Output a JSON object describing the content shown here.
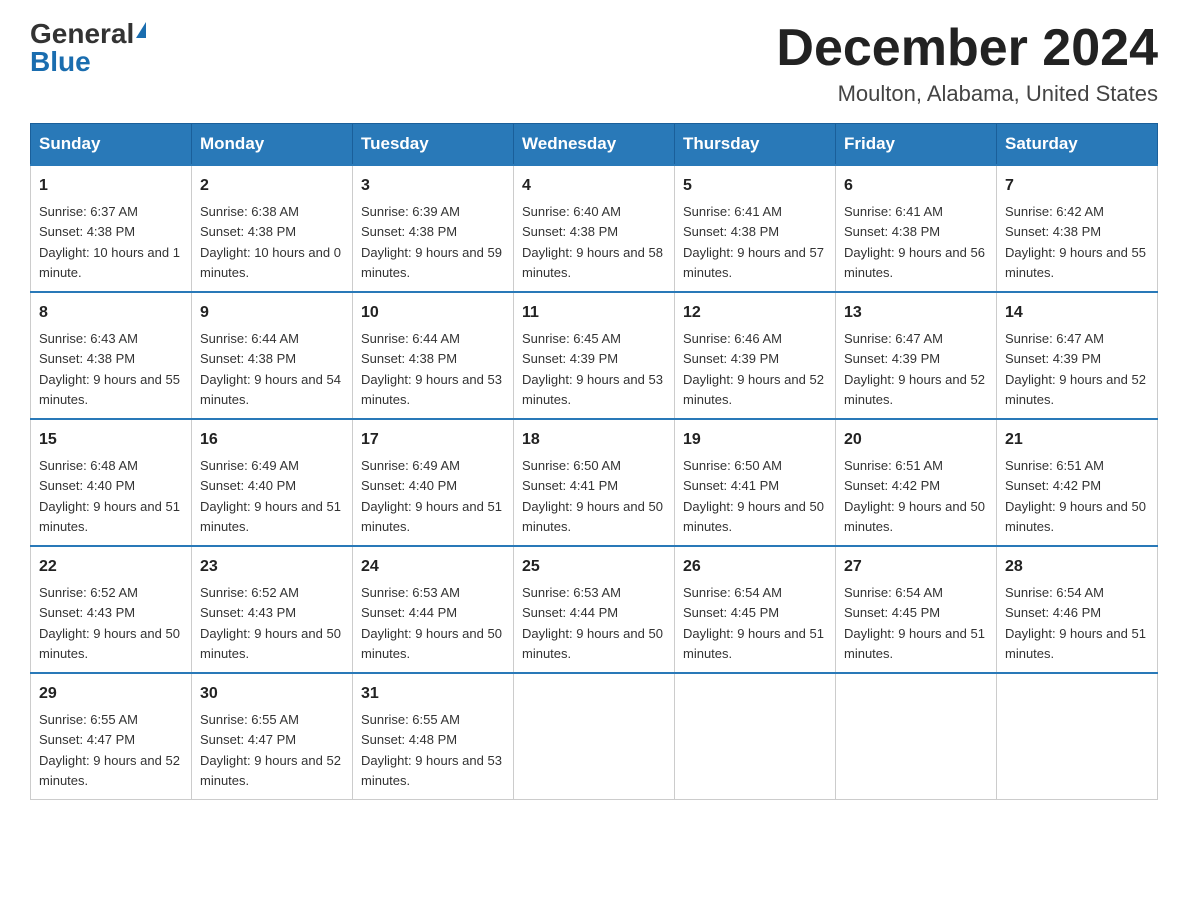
{
  "logo": {
    "general": "General",
    "blue": "Blue"
  },
  "title": {
    "month": "December 2024",
    "location": "Moulton, Alabama, United States"
  },
  "weekdays": [
    "Sunday",
    "Monday",
    "Tuesday",
    "Wednesday",
    "Thursday",
    "Friday",
    "Saturday"
  ],
  "weeks": [
    [
      {
        "day": "1",
        "sunrise": "6:37 AM",
        "sunset": "4:38 PM",
        "daylight": "10 hours and 1 minute."
      },
      {
        "day": "2",
        "sunrise": "6:38 AM",
        "sunset": "4:38 PM",
        "daylight": "10 hours and 0 minutes."
      },
      {
        "day": "3",
        "sunrise": "6:39 AM",
        "sunset": "4:38 PM",
        "daylight": "9 hours and 59 minutes."
      },
      {
        "day": "4",
        "sunrise": "6:40 AM",
        "sunset": "4:38 PM",
        "daylight": "9 hours and 58 minutes."
      },
      {
        "day": "5",
        "sunrise": "6:41 AM",
        "sunset": "4:38 PM",
        "daylight": "9 hours and 57 minutes."
      },
      {
        "day": "6",
        "sunrise": "6:41 AM",
        "sunset": "4:38 PM",
        "daylight": "9 hours and 56 minutes."
      },
      {
        "day": "7",
        "sunrise": "6:42 AM",
        "sunset": "4:38 PM",
        "daylight": "9 hours and 55 minutes."
      }
    ],
    [
      {
        "day": "8",
        "sunrise": "6:43 AM",
        "sunset": "4:38 PM",
        "daylight": "9 hours and 55 minutes."
      },
      {
        "day": "9",
        "sunrise": "6:44 AM",
        "sunset": "4:38 PM",
        "daylight": "9 hours and 54 minutes."
      },
      {
        "day": "10",
        "sunrise": "6:44 AM",
        "sunset": "4:38 PM",
        "daylight": "9 hours and 53 minutes."
      },
      {
        "day": "11",
        "sunrise": "6:45 AM",
        "sunset": "4:39 PM",
        "daylight": "9 hours and 53 minutes."
      },
      {
        "day": "12",
        "sunrise": "6:46 AM",
        "sunset": "4:39 PM",
        "daylight": "9 hours and 52 minutes."
      },
      {
        "day": "13",
        "sunrise": "6:47 AM",
        "sunset": "4:39 PM",
        "daylight": "9 hours and 52 minutes."
      },
      {
        "day": "14",
        "sunrise": "6:47 AM",
        "sunset": "4:39 PM",
        "daylight": "9 hours and 52 minutes."
      }
    ],
    [
      {
        "day": "15",
        "sunrise": "6:48 AM",
        "sunset": "4:40 PM",
        "daylight": "9 hours and 51 minutes."
      },
      {
        "day": "16",
        "sunrise": "6:49 AM",
        "sunset": "4:40 PM",
        "daylight": "9 hours and 51 minutes."
      },
      {
        "day": "17",
        "sunrise": "6:49 AM",
        "sunset": "4:40 PM",
        "daylight": "9 hours and 51 minutes."
      },
      {
        "day": "18",
        "sunrise": "6:50 AM",
        "sunset": "4:41 PM",
        "daylight": "9 hours and 50 minutes."
      },
      {
        "day": "19",
        "sunrise": "6:50 AM",
        "sunset": "4:41 PM",
        "daylight": "9 hours and 50 minutes."
      },
      {
        "day": "20",
        "sunrise": "6:51 AM",
        "sunset": "4:42 PM",
        "daylight": "9 hours and 50 minutes."
      },
      {
        "day": "21",
        "sunrise": "6:51 AM",
        "sunset": "4:42 PM",
        "daylight": "9 hours and 50 minutes."
      }
    ],
    [
      {
        "day": "22",
        "sunrise": "6:52 AM",
        "sunset": "4:43 PM",
        "daylight": "9 hours and 50 minutes."
      },
      {
        "day": "23",
        "sunrise": "6:52 AM",
        "sunset": "4:43 PM",
        "daylight": "9 hours and 50 minutes."
      },
      {
        "day": "24",
        "sunrise": "6:53 AM",
        "sunset": "4:44 PM",
        "daylight": "9 hours and 50 minutes."
      },
      {
        "day": "25",
        "sunrise": "6:53 AM",
        "sunset": "4:44 PM",
        "daylight": "9 hours and 50 minutes."
      },
      {
        "day": "26",
        "sunrise": "6:54 AM",
        "sunset": "4:45 PM",
        "daylight": "9 hours and 51 minutes."
      },
      {
        "day": "27",
        "sunrise": "6:54 AM",
        "sunset": "4:45 PM",
        "daylight": "9 hours and 51 minutes."
      },
      {
        "day": "28",
        "sunrise": "6:54 AM",
        "sunset": "4:46 PM",
        "daylight": "9 hours and 51 minutes."
      }
    ],
    [
      {
        "day": "29",
        "sunrise": "6:55 AM",
        "sunset": "4:47 PM",
        "daylight": "9 hours and 52 minutes."
      },
      {
        "day": "30",
        "sunrise": "6:55 AM",
        "sunset": "4:47 PM",
        "daylight": "9 hours and 52 minutes."
      },
      {
        "day": "31",
        "sunrise": "6:55 AM",
        "sunset": "4:48 PM",
        "daylight": "9 hours and 53 minutes."
      },
      null,
      null,
      null,
      null
    ]
  ]
}
